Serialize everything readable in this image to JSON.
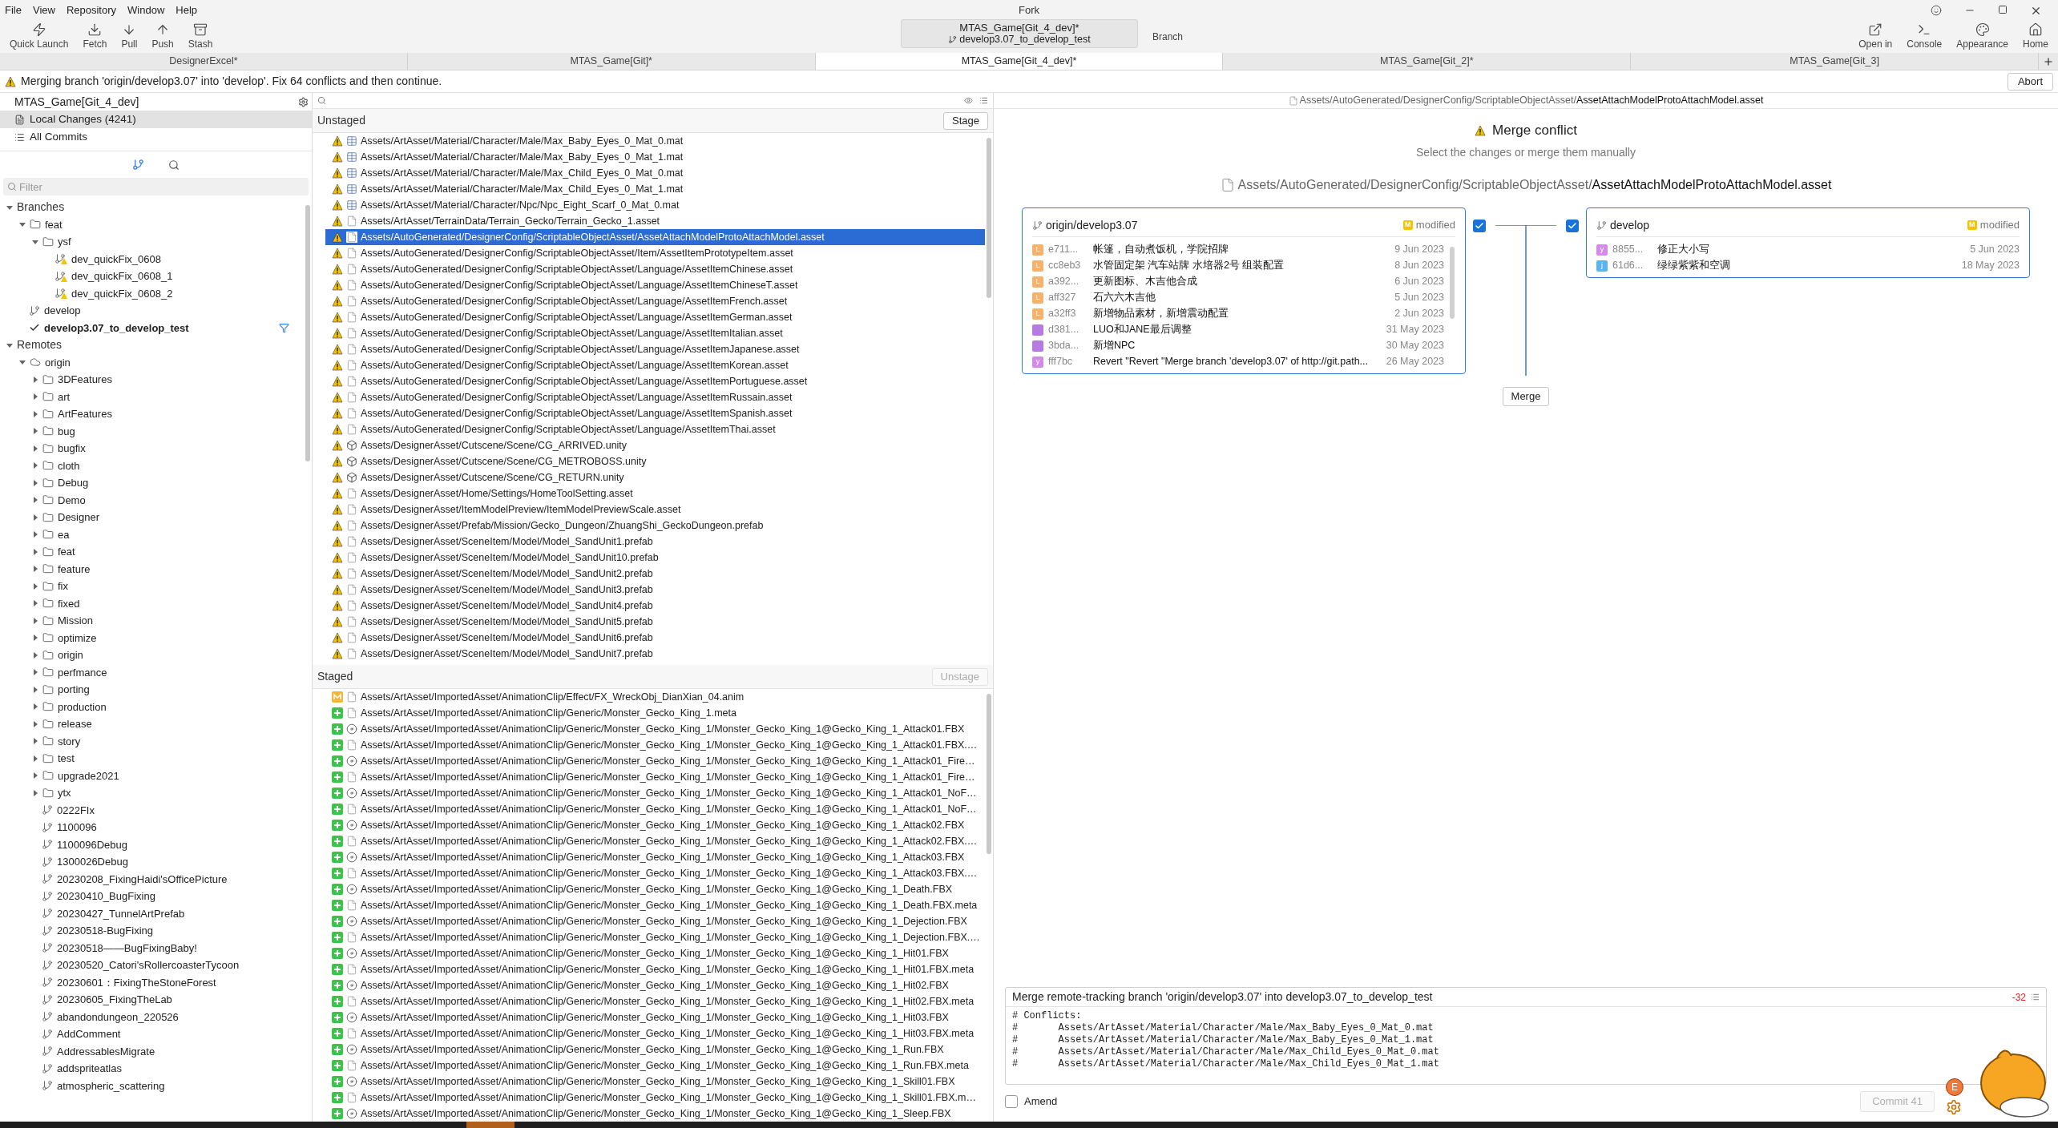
{
  "window": {
    "title": "Fork"
  },
  "menu": [
    "File",
    "View",
    "Repository",
    "Window",
    "Help"
  ],
  "toolbar": {
    "left": [
      {
        "label": "Quick Launch",
        "kind": "launch"
      },
      {
        "label": "Fetch",
        "kind": "fetch"
      },
      {
        "label": "Pull",
        "kind": "pull"
      },
      {
        "label": "Push",
        "kind": "push"
      },
      {
        "label": "Stash",
        "kind": "stash"
      }
    ],
    "repo": {
      "name": "MTAS_Game[Git_4_dev]*",
      "branch": "develop3.07_to_develop_test"
    },
    "branch_button": "Branch",
    "right": [
      {
        "label": "Open in",
        "kind": "open"
      },
      {
        "label": "Console",
        "kind": "console"
      },
      {
        "label": "Appearance",
        "kind": "appearance"
      },
      {
        "label": "Home",
        "kind": "home"
      }
    ]
  },
  "tabs": [
    {
      "label": "DesignerExcel*",
      "selected": false
    },
    {
      "label": "MTAS_Game[Git]*",
      "selected": false
    },
    {
      "label": "MTAS_Game[Git_4_dev]*",
      "selected": true
    },
    {
      "label": "MTAS_Game[Git_2]*",
      "selected": false
    },
    {
      "label": "MTAS_Game[Git_3]",
      "selected": false
    }
  ],
  "banner": {
    "message": "Merging branch 'origin/develop3.07' into 'develop'. Fix 64 conflicts and then continue.",
    "button": "Abort"
  },
  "sidebar": {
    "repo": "MTAS_Game[Git_4_dev]",
    "nav": [
      {
        "label": "Local Changes (4241)",
        "kind": "changes",
        "selected": true
      },
      {
        "label": "All Commits",
        "kind": "commits",
        "selected": false
      }
    ],
    "filter_placeholder": "Filter",
    "tree": [
      {
        "label": "Branches",
        "kind": "section",
        "expanded": true,
        "children": [
          {
            "label": "feat",
            "kind": "folder",
            "expanded": true,
            "children": [
              {
                "label": "ysf",
                "kind": "folder",
                "expanded": true,
                "children": [
                  {
                    "label": "dev_quickFix_0608",
                    "kind": "warn_branch"
                  },
                  {
                    "label": "dev_quickFix_0608_1",
                    "kind": "warn_branch"
                  },
                  {
                    "label": "dev_quickFix_0608_2",
                    "kind": "warn_branch"
                  }
                ]
              }
            ]
          },
          {
            "label": "develop",
            "kind": "branch",
            "current": false
          },
          {
            "label": "develop3.07_to_develop_test",
            "kind": "branch",
            "current": true
          }
        ]
      },
      {
        "label": "Remotes",
        "kind": "section",
        "expanded": true,
        "children": [
          {
            "label": "origin",
            "kind": "remote",
            "expanded": true,
            "children": [
              {
                "label": "3DFeatures",
                "kind": "folder",
                "expanded": false
              },
              {
                "label": "art",
                "kind": "folder",
                "expanded": false
              },
              {
                "label": "ArtFeatures",
                "kind": "folder",
                "expanded": false
              },
              {
                "label": "bug",
                "kind": "folder",
                "expanded": false
              },
              {
                "label": "bugfix",
                "kind": "folder",
                "expanded": false
              },
              {
                "label": "cloth",
                "kind": "folder",
                "expanded": false
              },
              {
                "label": "Debug",
                "kind": "folder",
                "expanded": false
              },
              {
                "label": "Demo",
                "kind": "folder",
                "expanded": false
              },
              {
                "label": "Designer",
                "kind": "folder",
                "expanded": false
              },
              {
                "label": "ea",
                "kind": "folder",
                "expanded": false
              },
              {
                "label": "feat",
                "kind": "folder",
                "expanded": false
              },
              {
                "label": "feature",
                "kind": "folder",
                "expanded": false
              },
              {
                "label": "fix",
                "kind": "folder",
                "expanded": false
              },
              {
                "label": "fixed",
                "kind": "folder",
                "expanded": false
              },
              {
                "label": "Mission",
                "kind": "folder",
                "expanded": false
              },
              {
                "label": "optimize",
                "kind": "folder",
                "expanded": false
              },
              {
                "label": "origin",
                "kind": "folder",
                "expanded": false
              },
              {
                "label": "perfmance",
                "kind": "folder",
                "expanded": false
              },
              {
                "label": "porting",
                "kind": "folder",
                "expanded": false
              },
              {
                "label": "production",
                "kind": "folder",
                "expanded": false
              },
              {
                "label": "release",
                "kind": "folder",
                "expanded": false
              },
              {
                "label": "story",
                "kind": "folder",
                "expanded": false
              },
              {
                "label": "test",
                "kind": "folder",
                "expanded": false
              },
              {
                "label": "upgrade2021",
                "kind": "folder",
                "expanded": false
              },
              {
                "label": "ytx",
                "kind": "folder",
                "expanded": false
              },
              {
                "label": "0222FIx",
                "kind": "branch"
              },
              {
                "label": "1100096",
                "kind": "branch"
              },
              {
                "label": "1100096Debug",
                "kind": "branch"
              },
              {
                "label": "1300026Debug",
                "kind": "branch"
              },
              {
                "label": "20230208_FixingHaidi'sOfficePicture",
                "kind": "branch"
              },
              {
                "label": "20230410_BugFixing",
                "kind": "branch"
              },
              {
                "label": "20230427_TunnelArtPrefab",
                "kind": "branch"
              },
              {
                "label": "20230518-BugFixing",
                "kind": "branch"
              },
              {
                "label": "20230518——BugFixingBaby!",
                "kind": "branch"
              },
              {
                "label": "20230520_Catori'sRollercoasterTycoon",
                "kind": "branch"
              },
              {
                "label": "20230601：FixingTheStoneForest",
                "kind": "branch"
              },
              {
                "label": "20230605_FixingTheLab",
                "kind": "branch"
              },
              {
                "label": "abandondungeon_220526",
                "kind": "branch"
              },
              {
                "label": "AddComment",
                "kind": "branch"
              },
              {
                "label": "AddressablesMigrate",
                "kind": "branch"
              },
              {
                "label": "addspriteatlas",
                "kind": "branch"
              },
              {
                "label": "atmospheric_scattering",
                "kind": "branch"
              }
            ]
          }
        ]
      }
    ]
  },
  "unstaged": {
    "title": "Unstaged",
    "button": {
      "label": "Stage",
      "disabled": false
    },
    "files": [
      {
        "path": "Assets/ArtAsset/Material/Character/Male/Max_Baby_Eyes_0_Mat_0.mat",
        "kind": "mat",
        "conflicted": true,
        "selected": false
      },
      {
        "path": "Assets/ArtAsset/Material/Character/Male/Max_Baby_Eyes_0_Mat_1.mat",
        "kind": "mat",
        "conflicted": true,
        "selected": false
      },
      {
        "path": "Assets/ArtAsset/Material/Character/Male/Max_Child_Eyes_0_Mat_0.mat",
        "kind": "mat",
        "conflicted": true,
        "selected": false
      },
      {
        "path": "Assets/ArtAsset/Material/Character/Male/Max_Child_Eyes_0_Mat_1.mat",
        "kind": "mat",
        "conflicted": true,
        "selected": false
      },
      {
        "path": "Assets/ArtAsset/Material/Character/Npc/Npc_Eight_Scarf_0_Mat_0.mat",
        "kind": "mat",
        "conflicted": true,
        "selected": false
      },
      {
        "path": "Assets/ArtAsset/TerrainData/Terrain_Gecko/Terrain_Gecko_1.asset",
        "kind": "file",
        "conflicted": true,
        "selected": false
      },
      {
        "path": "Assets/AutoGenerated/DesignerConfig/ScriptableObjectAsset/AssetAttachModelProtoAttachModel.asset",
        "kind": "file",
        "conflicted": true,
        "selected": true
      },
      {
        "path": "Assets/AutoGenerated/DesignerConfig/ScriptableObjectAsset/Item/AssetItemPrototypeItem.asset",
        "kind": "file",
        "conflicted": true,
        "selected": false
      },
      {
        "path": "Assets/AutoGenerated/DesignerConfig/ScriptableObjectAsset/Language/AssetItemChinese.asset",
        "kind": "file",
        "conflicted": true,
        "selected": false
      },
      {
        "path": "Assets/AutoGenerated/DesignerConfig/ScriptableObjectAsset/Language/AssetItemChineseT.asset",
        "kind": "file",
        "conflicted": true,
        "selected": false
      },
      {
        "path": "Assets/AutoGenerated/DesignerConfig/ScriptableObjectAsset/Language/AssetItemFrench.asset",
        "kind": "file",
        "conflicted": true,
        "selected": false
      },
      {
        "path": "Assets/AutoGenerated/DesignerConfig/ScriptableObjectAsset/Language/AssetItemGerman.asset",
        "kind": "file",
        "conflicted": true,
        "selected": false
      },
      {
        "path": "Assets/AutoGenerated/DesignerConfig/ScriptableObjectAsset/Language/AssetItemItalian.asset",
        "kind": "file",
        "conflicted": true,
        "selected": false
      },
      {
        "path": "Assets/AutoGenerated/DesignerConfig/ScriptableObjectAsset/Language/AssetItemJapanese.asset",
        "kind": "file",
        "conflicted": true,
        "selected": false
      },
      {
        "path": "Assets/AutoGenerated/DesignerConfig/ScriptableObjectAsset/Language/AssetItemKorean.asset",
        "kind": "file",
        "conflicted": true,
        "selected": false
      },
      {
        "path": "Assets/AutoGenerated/DesignerConfig/ScriptableObjectAsset/Language/AssetItemPortuguese.asset",
        "kind": "file",
        "conflicted": true,
        "selected": false
      },
      {
        "path": "Assets/AutoGenerated/DesignerConfig/ScriptableObjectAsset/Language/AssetItemRussain.asset",
        "kind": "file",
        "conflicted": true,
        "selected": false
      },
      {
        "path": "Assets/AutoGenerated/DesignerConfig/ScriptableObjectAsset/Language/AssetItemSpanish.asset",
        "kind": "file",
        "conflicted": true,
        "selected": false
      },
      {
        "path": "Assets/AutoGenerated/DesignerConfig/ScriptableObjectAsset/Language/AssetItemThai.asset",
        "kind": "file",
        "conflicted": true,
        "selected": false
      },
      {
        "path": "Assets/DesignerAsset/Cutscene/Scene/CG_ARRIVED.unity",
        "kind": "unity",
        "conflicted": true,
        "selected": false
      },
      {
        "path": "Assets/DesignerAsset/Cutscene/Scene/CG_METROBOSS.unity",
        "kind": "unity",
        "conflicted": true,
        "selected": false
      },
      {
        "path": "Assets/DesignerAsset/Cutscene/Scene/CG_RETURN.unity",
        "kind": "unity",
        "conflicted": true,
        "selected": false
      },
      {
        "path": "Assets/DesignerAsset/Home/Settings/HomeToolSetting.asset",
        "kind": "file",
        "conflicted": true,
        "selected": false
      },
      {
        "path": "Assets/DesignerAsset/ItemModelPreview/ItemModelPreviewScale.asset",
        "kind": "file",
        "conflicted": true,
        "selected": false
      },
      {
        "path": "Assets/DesignerAsset/Prefab/Mission/Gecko_Dungeon/ZhuangShi_GeckoDungeon.prefab",
        "kind": "file",
        "conflicted": true,
        "selected": false
      },
      {
        "path": "Assets/DesignerAsset/SceneItem/Model/Model_SandUnit1.prefab",
        "kind": "file",
        "conflicted": true,
        "selected": false
      },
      {
        "path": "Assets/DesignerAsset/SceneItem/Model/Model_SandUnit10.prefab",
        "kind": "file",
        "conflicted": true,
        "selected": false
      },
      {
        "path": "Assets/DesignerAsset/SceneItem/Model/Model_SandUnit2.prefab",
        "kind": "file",
        "conflicted": true,
        "selected": false
      },
      {
        "path": "Assets/DesignerAsset/SceneItem/Model/Model_SandUnit3.prefab",
        "kind": "file",
        "conflicted": true,
        "selected": false
      },
      {
        "path": "Assets/DesignerAsset/SceneItem/Model/Model_SandUnit4.prefab",
        "kind": "file",
        "conflicted": true,
        "selected": false
      },
      {
        "path": "Assets/DesignerAsset/SceneItem/Model/Model_SandUnit5.prefab",
        "kind": "file",
        "conflicted": true,
        "selected": false
      },
      {
        "path": "Assets/DesignerAsset/SceneItem/Model/Model_SandUnit6.prefab",
        "kind": "file",
        "conflicted": true,
        "selected": false
      },
      {
        "path": "Assets/DesignerAsset/SceneItem/Model/Model_SandUnit7.prefab",
        "kind": "file",
        "conflicted": true,
        "selected": false
      }
    ]
  },
  "staged": {
    "title": "Staged",
    "button": {
      "label": "Unstage",
      "disabled": true
    },
    "files": [
      {
        "path": "Assets/ArtAsset/ImportedAsset/AnimationClip/Effect/FX_WreckObj_DianXian_04.anim",
        "kind": "file",
        "modified": true,
        "selected": false
      },
      {
        "path": "Assets/ArtAsset/ImportedAsset/AnimationClip/Generic/Monster_Gecko_King_1.meta",
        "kind": "file",
        "modified": false,
        "selected": false
      },
      {
        "path": "Assets/ArtAsset/ImportedAsset/AnimationClip/Generic/Monster_Gecko_King_1/Monster_Gecko_King_1@Gecko_King_1_Attack01.FBX",
        "kind": "fbx",
        "modified": false,
        "selected": false
      },
      {
        "path": "Assets/ArtAsset/ImportedAsset/AnimationClip/Generic/Monster_Gecko_King_1/Monster_Gecko_King_1@Gecko_King_1_Attack01.FBX.…",
        "kind": "file",
        "modified": false,
        "selected": false
      },
      {
        "path": "Assets/ArtAsset/ImportedAsset/AnimationClip/Generic/Monster_Gecko_King_1/Monster_Gecko_King_1@Gecko_King_1_Attack01_Fire…",
        "kind": "fbx",
        "modified": false,
        "selected": false
      },
      {
        "path": "Assets/ArtAsset/ImportedAsset/AnimationClip/Generic/Monster_Gecko_King_1/Monster_Gecko_King_1@Gecko_King_1_Attack01_Fire…",
        "kind": "file",
        "modified": false,
        "selected": false
      },
      {
        "path": "Assets/ArtAsset/ImportedAsset/AnimationClip/Generic/Monster_Gecko_King_1/Monster_Gecko_King_1@Gecko_King_1_Attack01_NoF…",
        "kind": "fbx",
        "modified": false,
        "selected": false
      },
      {
        "path": "Assets/ArtAsset/ImportedAsset/AnimationClip/Generic/Monster_Gecko_King_1/Monster_Gecko_King_1@Gecko_King_1_Attack01_NoF…",
        "kind": "file",
        "modified": false,
        "selected": false
      },
      {
        "path": "Assets/ArtAsset/ImportedAsset/AnimationClip/Generic/Monster_Gecko_King_1/Monster_Gecko_King_1@Gecko_King_1_Attack02.FBX",
        "kind": "fbx",
        "modified": false,
        "selected": false
      },
      {
        "path": "Assets/ArtAsset/ImportedAsset/AnimationClip/Generic/Monster_Gecko_King_1/Monster_Gecko_King_1@Gecko_King_1_Attack02.FBX.…",
        "kind": "file",
        "modified": false,
        "selected": false
      },
      {
        "path": "Assets/ArtAsset/ImportedAsset/AnimationClip/Generic/Monster_Gecko_King_1/Monster_Gecko_King_1@Gecko_King_1_Attack03.FBX",
        "kind": "fbx",
        "modified": false,
        "selected": false
      },
      {
        "path": "Assets/ArtAsset/ImportedAsset/AnimationClip/Generic/Monster_Gecko_King_1/Monster_Gecko_King_1@Gecko_King_1_Attack03.FBX.…",
        "kind": "file",
        "modified": false,
        "selected": false
      },
      {
        "path": "Assets/ArtAsset/ImportedAsset/AnimationClip/Generic/Monster_Gecko_King_1/Monster_Gecko_King_1@Gecko_King_1_Death.FBX",
        "kind": "fbx",
        "modified": false,
        "selected": false
      },
      {
        "path": "Assets/ArtAsset/ImportedAsset/AnimationClip/Generic/Monster_Gecko_King_1/Monster_Gecko_King_1@Gecko_King_1_Death.FBX.meta",
        "kind": "file",
        "modified": false,
        "selected": false
      },
      {
        "path": "Assets/ArtAsset/ImportedAsset/AnimationClip/Generic/Monster_Gecko_King_1/Monster_Gecko_King_1@Gecko_King_1_Dejection.FBX",
        "kind": "fbx",
        "modified": false,
        "selected": false
      },
      {
        "path": "Assets/ArtAsset/ImportedAsset/AnimationClip/Generic/Monster_Gecko_King_1/Monster_Gecko_King_1@Gecko_King_1_Dejection.FBX.…",
        "kind": "file",
        "modified": false,
        "selected": false
      },
      {
        "path": "Assets/ArtAsset/ImportedAsset/AnimationClip/Generic/Monster_Gecko_King_1/Monster_Gecko_King_1@Gecko_King_1_Hit01.FBX",
        "kind": "fbx",
        "modified": false,
        "selected": false
      },
      {
        "path": "Assets/ArtAsset/ImportedAsset/AnimationClip/Generic/Monster_Gecko_King_1/Monster_Gecko_King_1@Gecko_King_1_Hit01.FBX.meta",
        "kind": "file",
        "modified": false,
        "selected": false
      },
      {
        "path": "Assets/ArtAsset/ImportedAsset/AnimationClip/Generic/Monster_Gecko_King_1/Monster_Gecko_King_1@Gecko_King_1_Hit02.FBX",
        "kind": "fbx",
        "modified": false,
        "selected": false
      },
      {
        "path": "Assets/ArtAsset/ImportedAsset/AnimationClip/Generic/Monster_Gecko_King_1/Monster_Gecko_King_1@Gecko_King_1_Hit02.FBX.meta",
        "kind": "file",
        "modified": false,
        "selected": false
      },
      {
        "path": "Assets/ArtAsset/ImportedAsset/AnimationClip/Generic/Monster_Gecko_King_1/Monster_Gecko_King_1@Gecko_King_1_Hit03.FBX",
        "kind": "fbx",
        "modified": false,
        "selected": false
      },
      {
        "path": "Assets/ArtAsset/ImportedAsset/AnimationClip/Generic/Monster_Gecko_King_1/Monster_Gecko_King_1@Gecko_King_1_Hit03.FBX.meta",
        "kind": "file",
        "modified": false,
        "selected": false
      },
      {
        "path": "Assets/ArtAsset/ImportedAsset/AnimationClip/Generic/Monster_Gecko_King_1/Monster_Gecko_King_1@Gecko_King_1_Run.FBX",
        "kind": "fbx",
        "modified": false,
        "selected": false
      },
      {
        "path": "Assets/ArtAsset/ImportedAsset/AnimationClip/Generic/Monster_Gecko_King_1/Monster_Gecko_King_1@Gecko_King_1_Run.FBX.meta",
        "kind": "file",
        "modified": false,
        "selected": false
      },
      {
        "path": "Assets/ArtAsset/ImportedAsset/AnimationClip/Generic/Monster_Gecko_King_1/Monster_Gecko_King_1@Gecko_King_1_Skill01.FBX",
        "kind": "fbx",
        "modified": false,
        "selected": false
      },
      {
        "path": "Assets/ArtAsset/ImportedAsset/AnimationClip/Generic/Monster_Gecko_King_1/Monster_Gecko_King_1@Gecko_King_1_Skill01.FBX.m…",
        "kind": "file",
        "modified": false,
        "selected": false
      },
      {
        "path": "Assets/ArtAsset/ImportedAsset/AnimationClip/Generic/Monster_Gecko_King_1/Monster_Gecko_King_1@Gecko_King_1_Sleep.FBX",
        "kind": "fbx",
        "modified": false,
        "selected": false
      }
    ]
  },
  "merge": {
    "path_prefix": "Assets/AutoGenerated/DesignerConfig/ScriptableObjectAsset/",
    "path_file": "AssetAttachModelProtoAttachModel.asset",
    "title": "Merge conflict",
    "subtitle": "Select the changes or merge them manually",
    "file_prefix": "Assets/AutoGenerated/DesignerConfig/ScriptableObjectAsset/",
    "file_name": "AssetAttachModelProtoAttachModel.asset",
    "sides": [
      {
        "branch": "origin/develop3.07",
        "badge": "M",
        "status": "modified",
        "checked": true,
        "commits": [
          {
            "avatar": "L",
            "color": "#f6b26b",
            "hash": "e711...",
            "message": "帐篷，自动煮饭机，学院招牌",
            "date": "9 Jun 2023"
          },
          {
            "avatar": "L",
            "color": "#f6b26b",
            "hash": "cc8eb3",
            "message": "水管固定架 汽车站牌 水培器2号 组装配置",
            "date": "8 Jun 2023"
          },
          {
            "avatar": "L",
            "color": "#f6b26b",
            "hash": "a392...",
            "message": "更新图标、木吉他合成",
            "date": "6 Jun 2023"
          },
          {
            "avatar": "L",
            "color": "#f6b26b",
            "hash": "aff327",
            "message": "石六六木吉他",
            "date": "5 Jun 2023"
          },
          {
            "avatar": "L",
            "color": "#f6b26b",
            "hash": "a32ff3",
            "message": "新增物品素材，新增震动配置",
            "date": "2 Jun 2023"
          },
          {
            "color": "#b57be0",
            "hash": "d381...",
            "message": "LUO和JANE最后调整",
            "date": "31 May 2023"
          },
          {
            "color": "#b57be0",
            "hash": "3bda...",
            "message": "新增NPC",
            "date": "30 May 2023"
          },
          {
            "avatar": "y",
            "color": "#d38be8",
            "hash": "fff7bc",
            "message": "Revert \"Revert \"Merge branch 'develop3.07' of http://git.path...",
            "date": "26 May 2023"
          }
        ]
      },
      {
        "branch": "develop",
        "badge": "M",
        "status": "modified",
        "checked": true,
        "commits": [
          {
            "avatar": "y",
            "color": "#d38be8",
            "hash": "8855...",
            "message": "修正大小写",
            "date": "5 Jun 2023"
          },
          {
            "avatar": "j",
            "color": "#5bb4ec",
            "hash": "61d6...",
            "message": "绿绿紫紫和空调",
            "date": "18 May 2023"
          }
        ]
      }
    ],
    "button": "Merge"
  },
  "commit": {
    "summary": "Merge remote-tracking branch 'origin/develop3.07' into develop3.07_to_develop_test",
    "counter": "-32",
    "body": [
      "# Conflicts:",
      "#       Assets/ArtAsset/Material/Character/Male/Max_Baby_Eyes_0_Mat_0.mat",
      "#       Assets/ArtAsset/Material/Character/Male/Max_Baby_Eyes_0_Mat_1.mat",
      "#       Assets/ArtAsset/Material/Character/Male/Max_Child_Eyes_0_Mat_0.mat",
      "#       Assets/ArtAsset/Material/Character/Male/Max_Child_Eyes_0_Mat_1.mat"
    ],
    "amend": {
      "label": "Amend",
      "checked": false
    },
    "button": {
      "label": "Commit 41",
      "disabled": true
    },
    "pet_buttons": [
      "E"
    ]
  }
}
